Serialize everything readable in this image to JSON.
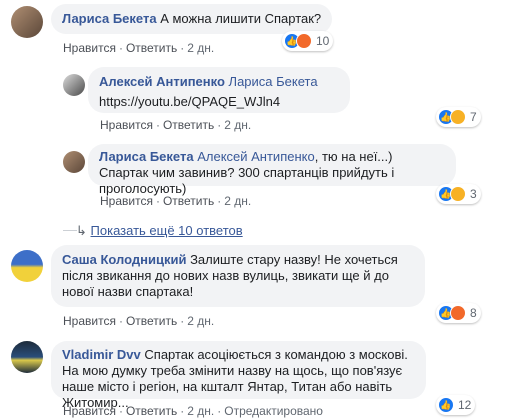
{
  "colors": {
    "link": "#385898",
    "bubble": "#f2f3f5",
    "like": "#1877f2",
    "angry": "#f2692a",
    "haha": "#f7b125"
  },
  "comments": [
    {
      "author": "Лариса Бекета",
      "text": "А можна лишити Спартак?",
      "actions": {
        "like": "Нравится",
        "reply": "Ответить",
        "time": "2 дн."
      },
      "reactions": {
        "icons": [
          "like-icon",
          "angry-icon"
        ],
        "count": "10"
      }
    },
    {
      "author": "Алексей Антипенко",
      "reply_to": "Лариса Бекета",
      "text": "https://youtu.be/QPAQE_WJln4",
      "actions": {
        "like": "Нравится",
        "reply": "Ответить",
        "time": "2 дн."
      },
      "reactions": {
        "icons": [
          "like-icon",
          "haha-icon"
        ],
        "count": "7"
      }
    },
    {
      "author": "Лариса Бекета",
      "reply_to": "Алексей Антипенко",
      "text": ", тю на неї...) Спартак чим завинив? 300 спартанців прийдуть і проголосують)",
      "actions": {
        "like": "Нравится",
        "reply": "Ответить",
        "time": "2 дн."
      },
      "reactions": {
        "icons": [
          "like-icon",
          "haha-icon"
        ],
        "count": "3"
      }
    },
    {
      "more_replies": "Показать ещё 10 ответов"
    },
    {
      "author": "Саша Колодницкий",
      "text": "Залиште стару назву! Не хочеться після звикання до нових назв вулиць, звикати ще й до нової назви спартака!",
      "actions": {
        "like": "Нравится",
        "reply": "Ответить",
        "time": "2 дн."
      },
      "reactions": {
        "icons": [
          "like-icon",
          "angry-icon"
        ],
        "count": "8"
      }
    },
    {
      "author": "Vladimir Dvv",
      "text": "Спартак асоціюється з командою з москові. На мою думку треба змінити назву на щось, що пов'язує наше місто і регіон, на кшталт Янтар, Титан або навіть Житомир...",
      "actions": {
        "like": "Нравится",
        "reply": "Ответить",
        "time": "2 дн.",
        "edited": "Отредактировано"
      },
      "reactions": {
        "icons": [
          "like-icon"
        ],
        "count": "12"
      }
    }
  ]
}
